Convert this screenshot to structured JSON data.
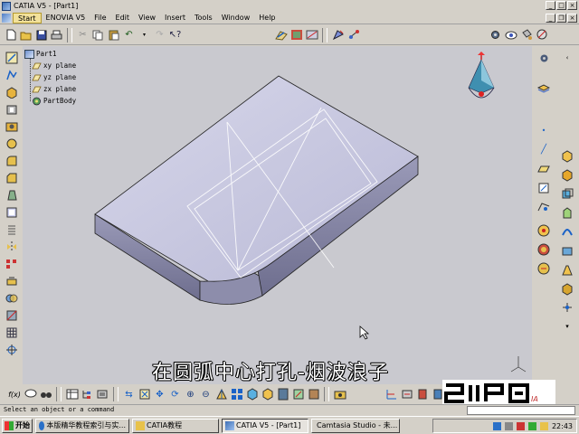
{
  "window": {
    "title": "CATIA V5 - [Part1]",
    "controls": [
      "minimize-icon",
      "maximize-icon",
      "close-icon"
    ]
  },
  "menu": {
    "items": [
      "Start",
      "ENOVIA V5",
      "File",
      "Edit",
      "View",
      "Insert",
      "Tools",
      "Window",
      "Help"
    ]
  },
  "tree": {
    "root": "Part1",
    "children": [
      "xy plane",
      "yz plane",
      "zx plane",
      "PartBody"
    ]
  },
  "subtitle": "在圆弧中心打孔-烟波浪子",
  "bottom_toolbar": {
    "formula_label": "f(x)"
  },
  "statusbar": {
    "text": "Select an object or a command"
  },
  "taskbar": {
    "start_label": "开始",
    "buttons": [
      {
        "label": "本版精华教程索引与实...",
        "icon": "ie-icon"
      },
      {
        "label": "CATIA教程",
        "icon": "folder-icon"
      },
      {
        "label": "CATIA V5 - [Part1]",
        "icon": "catia-icon",
        "active": true
      },
      {
        "label": "Camtasia Studio - 未...",
        "icon": "camtasia-icon"
      }
    ],
    "clock": "22:43"
  },
  "colors": {
    "viewport_bg": "#c9c9cf",
    "part_face": "#c6c6e0",
    "part_side": "#8a8aa8",
    "highlight_menu": "#f2e19a"
  }
}
